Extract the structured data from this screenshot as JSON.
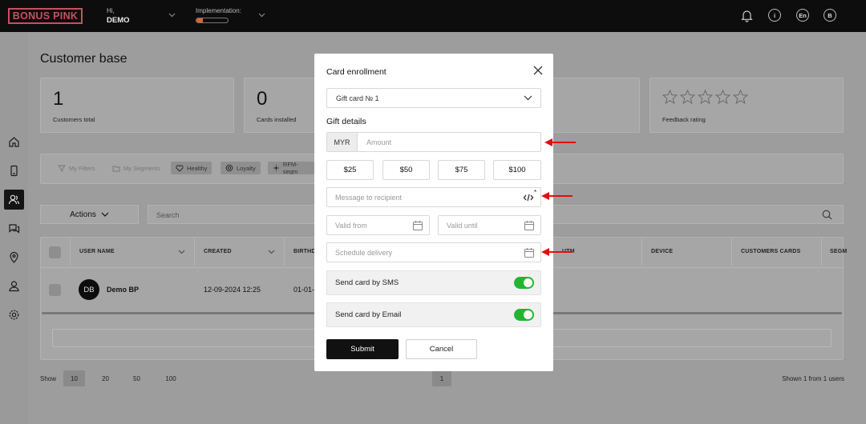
{
  "topbar": {
    "logo": "BONUS PINK",
    "greeting": "Hi,",
    "user_name": "DEMO",
    "implementation_label": "Implementation:",
    "implementation_progress": 0.2,
    "language": "En",
    "profile_initial": "B",
    "info_glyph": "i"
  },
  "page": {
    "title": "Customer base",
    "stats": [
      {
        "value": "1",
        "label": "Customers total"
      },
      {
        "value": "0",
        "label": "Cards installed"
      }
    ],
    "feedback_label": "Feedback rating",
    "filters": [
      "My Filters",
      "My Segments",
      "Healthy",
      "Loyalty",
      "RFM-segm"
    ],
    "actions_label": "Actions",
    "search_placeholder": "Search",
    "table": {
      "headers": [
        "USER NAME",
        "CREATED",
        "BIRTHD",
        "UTM",
        "DEVICE",
        "CUSTOMERS CARDS",
        "SEGM"
      ],
      "rows": [
        {
          "initials": "DB",
          "name": "Demo BP",
          "created": "12-09-2024 12:25",
          "birthday": "01-01-"
        }
      ]
    },
    "show_label": "Show",
    "page_sizes": [
      "10",
      "20",
      "50",
      "100"
    ],
    "current_page": "1",
    "shown_text": "Shown 1 from 1 users"
  },
  "modal": {
    "title": "Card enrollment",
    "card_select": "Gift card № 1",
    "section_title": "Gift details",
    "currency": "MYR",
    "amount_placeholder": "Amount",
    "presets": [
      "$25",
      "$50",
      "$75",
      "$100"
    ],
    "message_placeholder": "Message to recipient",
    "required_mark": "*",
    "valid_from_placeholder": "Valid from",
    "valid_until_placeholder": "Valid until",
    "schedule_placeholder": "Schedule delivery",
    "sms_label": "Send card by SMS",
    "sms_enabled": true,
    "email_label": "Send card by Email",
    "email_enabled": true,
    "submit_label": "Submit",
    "cancel_label": "Cancel"
  },
  "colors": {
    "brand": "#c8505f",
    "toggle_on": "#23b532",
    "annotation_arrow": "#e01010",
    "progress": "#d9672a"
  }
}
